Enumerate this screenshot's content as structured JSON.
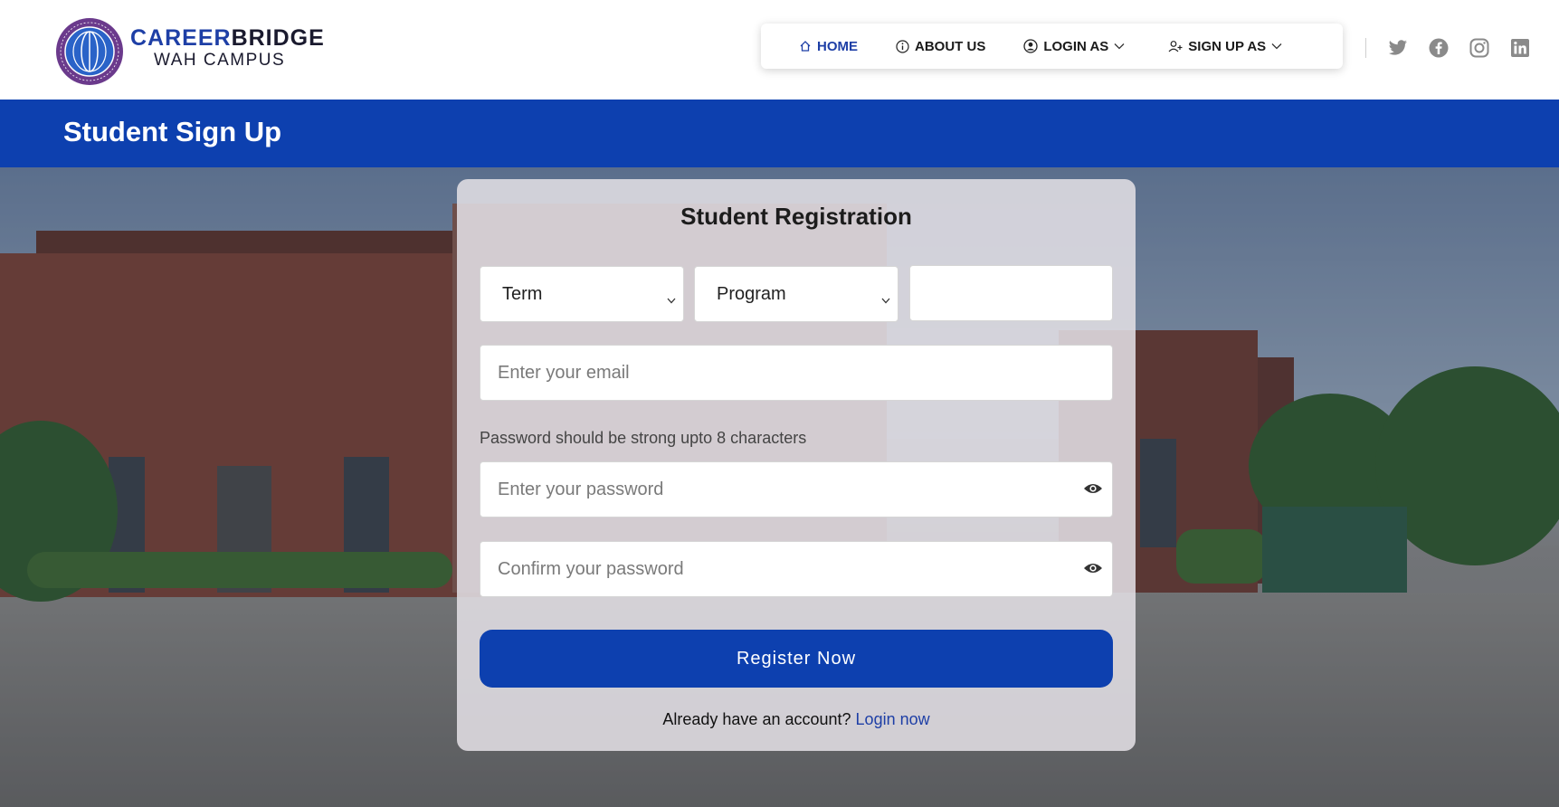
{
  "brand": {
    "name_part1": "CAREER",
    "name_part2": "BRIDGE",
    "campus": "WAH CAMPUS",
    "logo_icon": "university-seal"
  },
  "nav": {
    "items": [
      {
        "label": "HOME",
        "icon": "home-icon",
        "active": true
      },
      {
        "label": "ABOUT US",
        "icon": "info-icon",
        "active": false
      },
      {
        "label": "LOGIN AS",
        "icon": "user-circle-icon",
        "dropdown": true
      },
      {
        "label": "SIGN UP AS",
        "icon": "user-plus-icon",
        "dropdown": true
      }
    ]
  },
  "social": [
    "twitter-icon",
    "facebook-icon",
    "instagram-icon",
    "linkedin-icon"
  ],
  "banner": {
    "title": "Student Sign Up"
  },
  "form": {
    "title": "Student Registration",
    "term_select": "Term",
    "program_select": "Program",
    "roll_value": "",
    "email_placeholder": "Enter your email",
    "password_hint": "Password should be strong upto 8 characters",
    "password_placeholder": "Enter your password",
    "confirm_placeholder": "Confirm your password",
    "submit_label": "Register Now",
    "footer_text": "Already have an account?",
    "login_link": "Login now"
  },
  "colors": {
    "primary": "#0d40af",
    "brand_blue": "#1e3fa6",
    "card_bg": "#e1dee4"
  }
}
